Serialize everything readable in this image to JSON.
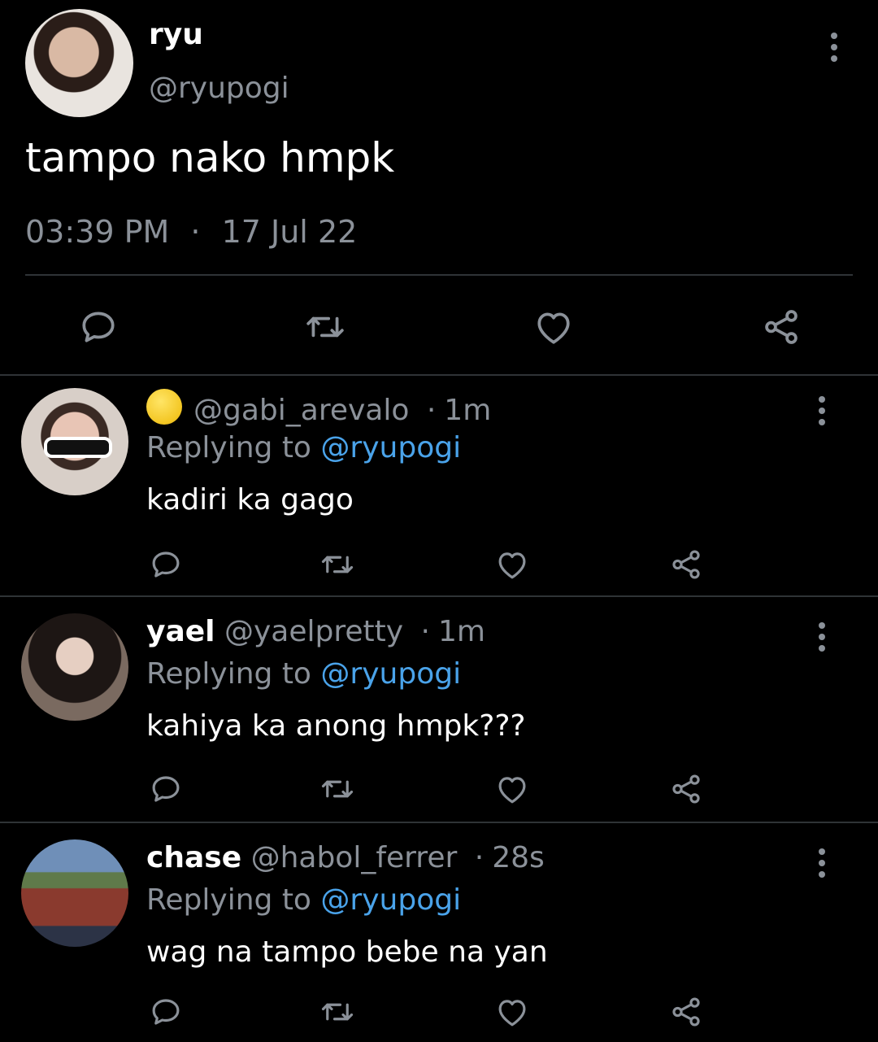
{
  "main_tweet": {
    "name": "ryu",
    "handle": "@ryupogi",
    "text": "tampo nako hmpk",
    "time": "03:39 PM",
    "separator": "·",
    "date": "17 Jul 22",
    "actions": [
      "reply-icon",
      "retweet-icon",
      "like-icon",
      "share-icon"
    ]
  },
  "replies": [
    {
      "name": "",
      "emoji": "moon-emoji",
      "handle": "@gabi_arevalo",
      "separator": "·",
      "time": "1m",
      "replying_prefix": "Replying to",
      "replying_to": "@ryupogi",
      "text": "kadiri ka gago"
    },
    {
      "name": "yael",
      "handle": "@yaelpretty",
      "separator": "·",
      "time": "1m",
      "replying_prefix": "Replying to",
      "replying_to": "@ryupogi",
      "text": "kahiya ka anong hmpk???"
    },
    {
      "name": "chase",
      "handle": "@habol_ferrer",
      "separator": "·",
      "time": "28s",
      "replying_prefix": "Replying to",
      "replying_to": "@ryupogi",
      "text": "wag na tampo bebe na yan"
    }
  ],
  "colors": {
    "background": "#000000",
    "text": "#ffffff",
    "secondary": "#8b9199",
    "mention": "#4aa3ea",
    "divider": "#2f3336"
  }
}
